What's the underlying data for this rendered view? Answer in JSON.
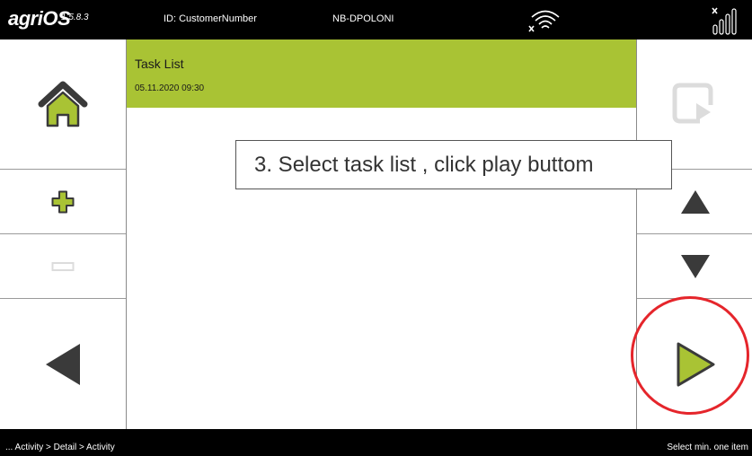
{
  "topbar": {
    "brand": "agriOS",
    "version": "1.5.8.3",
    "device_id": "ID: CustomerNumber",
    "device_name": "NB-DPOLONI",
    "wifi_icon": "wifi-disconnected-icon",
    "signal_icon": "signal-bars-icon"
  },
  "left_panel": {
    "buttons": [
      {
        "icon": "home-icon",
        "enabled": true
      },
      {
        "icon": "plus-icon",
        "enabled": true
      },
      {
        "icon": "minus-icon",
        "enabled": false
      },
      {
        "icon": "back-arrow-icon",
        "enabled": true
      }
    ]
  },
  "right_panel": {
    "buttons": [
      {
        "icon": "export-icon",
        "enabled": false
      },
      {
        "icon": "up-arrow-icon",
        "enabled": true
      },
      {
        "icon": "down-arrow-icon",
        "enabled": true
      },
      {
        "icon": "play-icon",
        "enabled": true
      }
    ]
  },
  "task_list": {
    "items": [
      {
        "title": "Task List",
        "date": "05.11.2020 09:30",
        "selected": true
      }
    ]
  },
  "annotation": {
    "callout_text": "3. Select task list , click play buttom"
  },
  "bottombar": {
    "breadcrumb": "... Activity > Detail > Activity",
    "status": "Select min. one item"
  },
  "colors": {
    "accent_green": "#a9c334",
    "icon_dark": "#3a3a3a",
    "icon_disabled": "#dcdcdc",
    "annotation_red": "#e5252b",
    "bar_black": "#000000"
  }
}
